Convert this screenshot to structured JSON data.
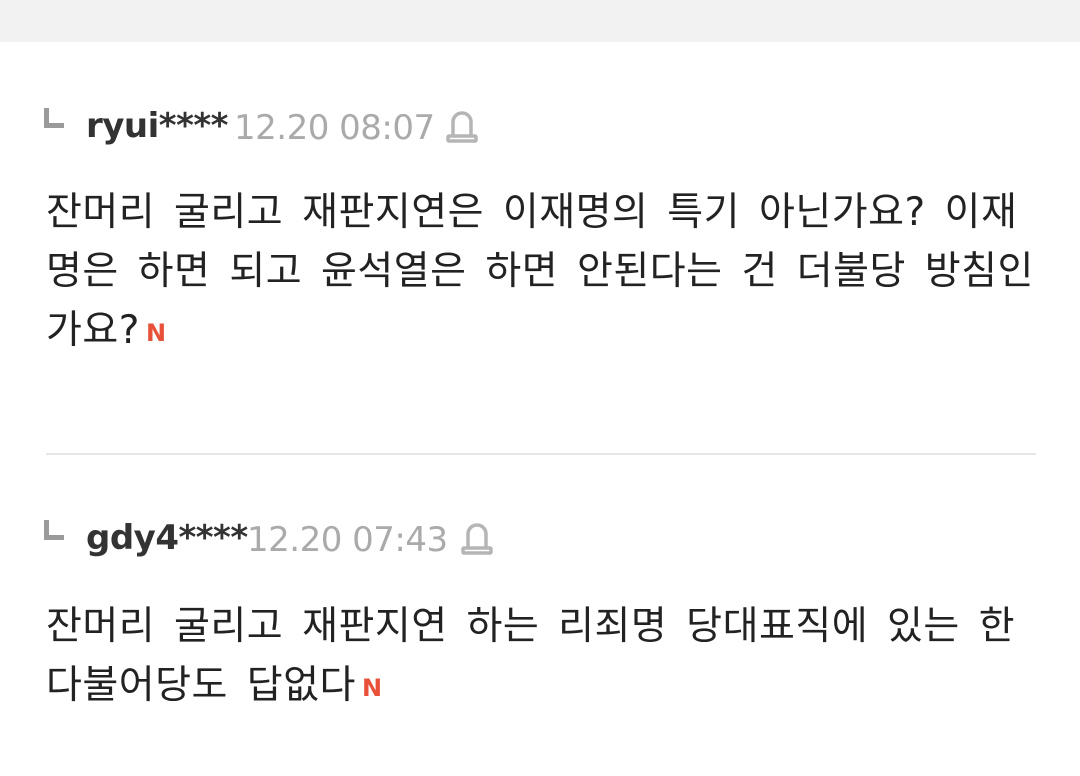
{
  "comments": [
    {
      "username": "ryui****",
      "timestamp": "12.20 08:07",
      "text": "잔머리 굴리고 재판지연은 이재명의 특기 아닌가요? 이재명은 하면 되고 윤석열은 하면 안된다는 건 더불당 방침인가요?",
      "new_badge": "N"
    },
    {
      "username": "gdy4****",
      "timestamp": "12.20 07:43",
      "text": "잔머리 굴리고 재판지연 하는 리죄명 당대표직에 있는 한 다불어당도 답없다",
      "new_badge": "N"
    }
  ],
  "colors": {
    "new_badge": "#e8503a",
    "username": "#333333",
    "timestamp": "#aaaaaa",
    "body": "#222222",
    "divider": "#e6e6e6",
    "top_strip": "#f2f2f2"
  },
  "icons": [
    "reply-arrow-icon",
    "report-siren-icon"
  ]
}
